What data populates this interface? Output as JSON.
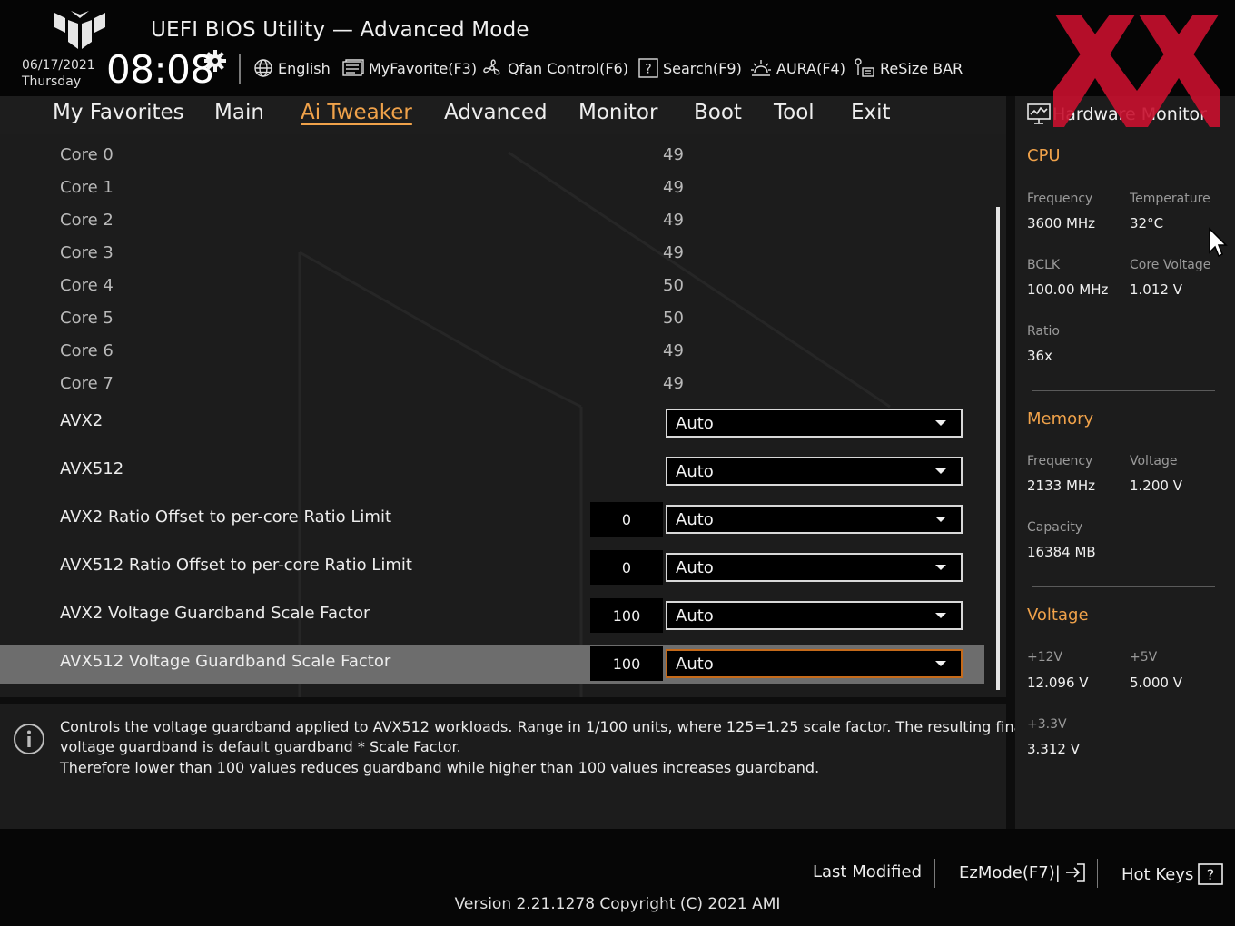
{
  "header": {
    "title": "UEFI BIOS Utility — Advanced Mode",
    "date": "06/17/2021",
    "day": "Thursday",
    "time": "08:08",
    "tools": [
      {
        "label": "English",
        "icon": "globe-icon"
      },
      {
        "label": "MyFavorite(F3)",
        "icon": "favorite-icon"
      },
      {
        "label": "Qfan Control(F6)",
        "icon": "fan-icon"
      },
      {
        "label": "Search(F9)",
        "icon": "search-icon"
      },
      {
        "label": "AURA(F4)",
        "icon": "aura-icon"
      },
      {
        "label": "ReSize BAR",
        "icon": "resize-bar-icon"
      }
    ]
  },
  "nav": {
    "tabs": [
      {
        "label": "My Favorites"
      },
      {
        "label": "Main"
      },
      {
        "label": "Ai Tweaker",
        "active": true
      },
      {
        "label": "Advanced"
      },
      {
        "label": "Monitor"
      },
      {
        "label": "Boot"
      },
      {
        "label": "Tool"
      },
      {
        "label": "Exit"
      }
    ]
  },
  "main": {
    "cores": [
      {
        "label": "Core 0",
        "value": "49"
      },
      {
        "label": "Core 1",
        "value": "49"
      },
      {
        "label": "Core 2",
        "value": "49"
      },
      {
        "label": "Core 3",
        "value": "49"
      },
      {
        "label": "Core 4",
        "value": "50"
      },
      {
        "label": "Core 5",
        "value": "50"
      },
      {
        "label": "Core 6",
        "value": "49"
      },
      {
        "label": "Core 7",
        "value": "49"
      }
    ],
    "settings": [
      {
        "label": "AVX2",
        "input": "",
        "selected": "Auto"
      },
      {
        "label": "AVX512",
        "input": "",
        "selected": "Auto"
      },
      {
        "label": "AVX2 Ratio Offset to per-core Ratio Limit",
        "input": "0",
        "selected": "Auto"
      },
      {
        "label": "AVX512 Ratio Offset to per-core Ratio Limit",
        "input": "0",
        "selected": "Auto"
      },
      {
        "label": "AVX2 Voltage Guardband Scale Factor",
        "input": "100",
        "selected": "Auto"
      },
      {
        "label": "AVX512 Voltage Guardband Scale Factor",
        "input": "100",
        "selected": "Auto",
        "highlighted": true
      }
    ]
  },
  "help": {
    "lines": [
      "Controls the voltage guardband applied to AVX512 workloads. Range in 1/100 units, where 125=1.25 scale factor. The resulting final",
      "voltage guardband is default guardband * Scale Factor.",
      "Therefore lower than 100 values reduces guardband while higher than 100 values increases guardband."
    ]
  },
  "hwmon": {
    "title": "Hardware Monitor",
    "cpu": {
      "heading": "CPU",
      "frequency_label": "Frequency",
      "frequency": "3600 MHz",
      "temperature_label": "Temperature",
      "temperature": "32°C",
      "bclk_label": "BCLK",
      "bclk": "100.00 MHz",
      "core_voltage_label": "Core Voltage",
      "core_voltage": "1.012 V",
      "ratio_label": "Ratio",
      "ratio": "36x"
    },
    "memory": {
      "heading": "Memory",
      "frequency_label": "Frequency",
      "frequency": "2133 MHz",
      "voltage_label": "Voltage",
      "voltage": "1.200 V",
      "capacity_label": "Capacity",
      "capacity": "16384 MB"
    },
    "voltage": {
      "heading": "Voltage",
      "v12_label": "+12V",
      "v12": "12.096 V",
      "v5_label": "+5V",
      "v5": "5.000 V",
      "v33_label": "+3.3V",
      "v33": "3.312 V"
    }
  },
  "footer": {
    "last_modified": "Last Modified",
    "ezmode": "EzMode(F7)|",
    "hotkeys": "Hot Keys",
    "version": "Version 2.21.1278 Copyright (C) 2021 AMI"
  },
  "colors": {
    "accent": "#f0a24a",
    "selected_border": "#c56a1a",
    "panel_bg": "#1c1c1c",
    "watermark": "#c8102e"
  }
}
